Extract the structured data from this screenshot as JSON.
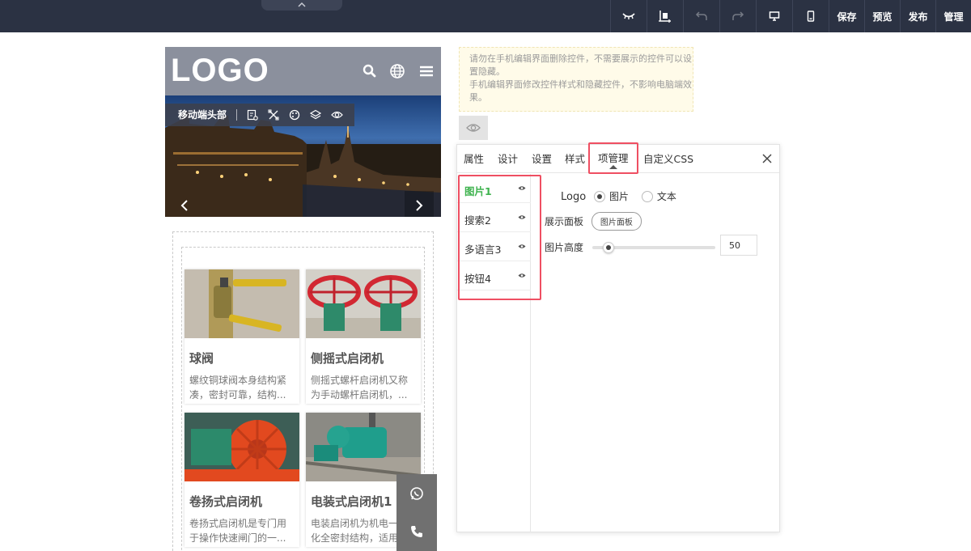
{
  "toolbar": {
    "buttons": [
      {
        "icon": "collapse-eye-icon"
      },
      {
        "icon": "align-icon"
      },
      {
        "icon": "undo-icon"
      },
      {
        "icon": "redo-icon"
      },
      {
        "icon": "desktop-icon"
      },
      {
        "icon": "mobile-icon"
      },
      {
        "label": "保存"
      },
      {
        "label": "预览"
      },
      {
        "label": "发布"
      },
      {
        "label": "管理"
      }
    ]
  },
  "mobile": {
    "logo": "LOGO",
    "edit_bar_label": "移动端头部",
    "products": [
      {
        "title": "球阀",
        "desc": "螺纹铜球阀本身结构紧凑，密封可靠，结构..."
      },
      {
        "title": "侧摇式启闭机",
        "desc": "侧摇式螺杆启闭机又称为手动螺杆启闭机，..."
      },
      {
        "title": "卷扬式启闭机",
        "desc": "卷扬式启闭机是专门用于操作快速闸门的一..."
      },
      {
        "title": "电装式启闭机1",
        "desc": "电装启闭机为机电一体化全密封结构，适用..."
      }
    ]
  },
  "tip": {
    "line1": "请勿在手机编辑界面删除控件，不需要展示的控件可以设置隐藏。",
    "line2": "手机编辑界面修改控件样式和隐藏控件，不影响电脑端效果。"
  },
  "panel": {
    "tabs": [
      "属性",
      "设计",
      "设置",
      "样式",
      "项管理",
      "自定义CSS"
    ],
    "active_tab": "项管理",
    "items": [
      {
        "name": "图片1",
        "selected": true
      },
      {
        "name": "搜索2",
        "selected": false
      },
      {
        "name": "多语言3",
        "selected": false
      },
      {
        "name": "按钮4",
        "selected": false
      }
    ],
    "form": {
      "logo_label": "Logo",
      "option_image": "图片",
      "option_text": "文本",
      "selected_option": "图片",
      "display_panel_label": "展示面板",
      "image_panel_button": "图片面板",
      "image_height_label": "图片高度",
      "image_height_value": "50",
      "slider_fraction": 0.05
    }
  },
  "colors": {
    "topbar": "#2b3243",
    "highlight": "#ef4f62",
    "selected_item": "#3fb34f",
    "phone_header": "#8b909d"
  }
}
